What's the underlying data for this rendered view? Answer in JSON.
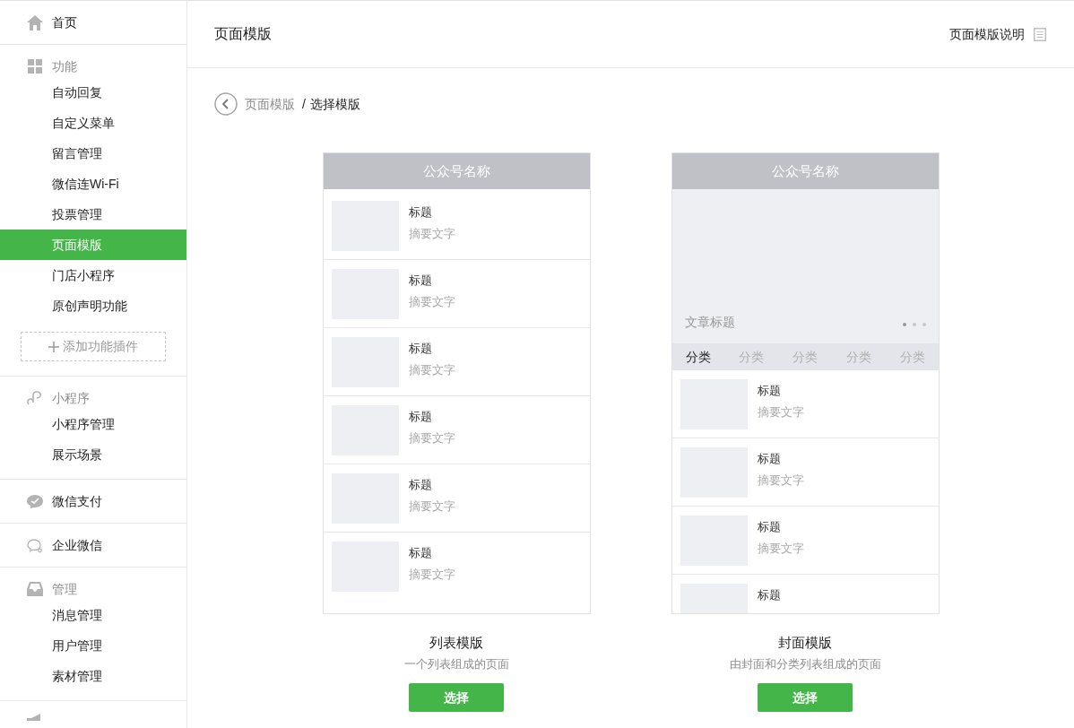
{
  "sidebar": {
    "sections": [
      {
        "kind": "link",
        "label": "首页",
        "selected": false
      },
      {
        "kind": "group",
        "label": "功能",
        "items": [
          {
            "label": "自动回复",
            "selected": false
          },
          {
            "label": "自定义菜单",
            "selected": false
          },
          {
            "label": "留言管理",
            "selected": false
          },
          {
            "label": "微信连Wi-Fi",
            "selected": false
          },
          {
            "label": "投票管理",
            "selected": false
          },
          {
            "label": "页面模版",
            "selected": true
          },
          {
            "label": "门店小程序",
            "selected": false
          },
          {
            "label": "原创声明功能",
            "selected": false
          }
        ],
        "add_button": "添加功能插件"
      },
      {
        "kind": "group",
        "label": "小程序",
        "items": [
          {
            "label": "小程序管理",
            "selected": false
          },
          {
            "label": "展示场景",
            "selected": false
          }
        ]
      },
      {
        "kind": "link",
        "label": "微信支付",
        "selected": false
      },
      {
        "kind": "link",
        "label": "企业微信",
        "selected": false
      },
      {
        "kind": "group",
        "label": "管理",
        "items": [
          {
            "label": "消息管理",
            "selected": false
          },
          {
            "label": "用户管理",
            "selected": false
          },
          {
            "label": "素材管理",
            "selected": false
          }
        ]
      },
      {
        "kind": "partial"
      }
    ]
  },
  "header": {
    "title": "页面模版",
    "help_link": "页面模版说明"
  },
  "breadcrumb": [
    {
      "label": "页面模版",
      "current": false
    },
    {
      "label": "选择模版",
      "current": true
    }
  ],
  "breadcrumb_separator": "/",
  "templates": [
    {
      "kind": "list",
      "header": "公众号名称",
      "items": [
        {
          "title": "标题",
          "summary": "摘要文字"
        },
        {
          "title": "标题",
          "summary": "摘要文字"
        },
        {
          "title": "标题",
          "summary": "摘要文字"
        },
        {
          "title": "标题",
          "summary": "摘要文字"
        },
        {
          "title": "标题",
          "summary": "摘要文字"
        },
        {
          "title": "标题",
          "summary": "摘要文字"
        }
      ],
      "name": "列表模版",
      "description": "一个列表组成的页面",
      "button": "选择"
    },
    {
      "kind": "cover",
      "header": "公众号名称",
      "cover_title": "文章标题",
      "categories": [
        {
          "label": "分类",
          "selected": true
        },
        {
          "label": "分类",
          "selected": false
        },
        {
          "label": "分类",
          "selected": false
        },
        {
          "label": "分类",
          "selected": false
        },
        {
          "label": "分类",
          "selected": false
        }
      ],
      "items": [
        {
          "title": "标题",
          "summary": "摘要文字"
        },
        {
          "title": "标题",
          "summary": "摘要文字"
        },
        {
          "title": "标题",
          "summary": "摘要文字"
        },
        {
          "title": "标题"
        }
      ],
      "name": "封面模版",
      "description": "由封面和分类列表组成的页面",
      "button": "选择"
    }
  ]
}
